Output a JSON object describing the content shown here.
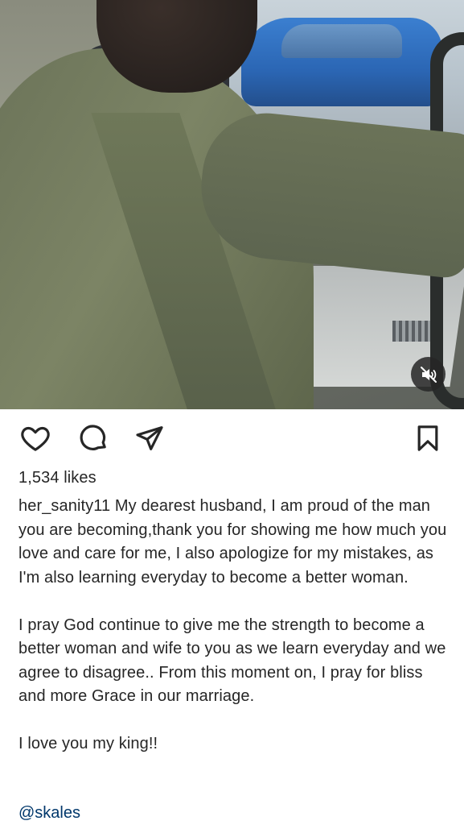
{
  "post": {
    "media": {
      "type": "video",
      "mute_icon": "volume-muted-icon"
    },
    "actions": {
      "like_icon": "heart-outline-icon",
      "comment_icon": "comment-bubble-icon",
      "share_icon": "paper-plane-icon",
      "save_icon": "bookmark-outline-icon"
    },
    "likes_text": "1,534 likes",
    "username": "her_sanity11",
    "caption_paragraph_1": "My dearest husband, I am proud of the man you are becoming,thank you for showing me how much you love and care for me, I also apologize for my mistakes, as I'm also learning everyday to become a better woman.",
    "caption_paragraph_2": "I pray God continue to give me the strength to become a better woman and wife to you as we learn everyday and we agree to disagree.. From this moment on, I pray for bliss and more Grace in our marriage.",
    "caption_paragraph_3": "I love you my king!!",
    "mention": "@skales",
    "colors": {
      "text": "#262626",
      "mention": "#00376b",
      "background": "#ffffff"
    }
  }
}
